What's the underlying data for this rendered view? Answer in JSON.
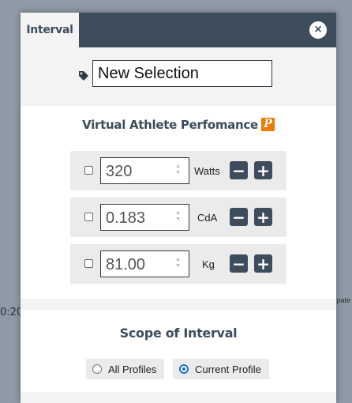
{
  "background": {
    "left_axis_label": "0:20",
    "right_axis_label": "pate"
  },
  "dialog": {
    "tab_label": "Interval",
    "close_icon": "close-icon",
    "name_field": {
      "value": "New Selection",
      "icon": "tag-icon"
    }
  },
  "performance": {
    "title": "Virtual Athlete Perfomance",
    "badge": "P",
    "rows": [
      {
        "value": "320",
        "unit": "Watts"
      },
      {
        "value": "0.183",
        "unit": "CdA"
      },
      {
        "value": "81.00",
        "unit": "Kg"
      }
    ],
    "minus_label": "−",
    "plus_label": "+"
  },
  "scope": {
    "title": "Scope of Interval",
    "options": [
      {
        "label": "All Profiles",
        "selected": false
      },
      {
        "label": "Current Profile",
        "selected": true
      }
    ]
  },
  "colors": {
    "header": "#3e4d5c",
    "accent": "#1a73c9",
    "badge": "#f07a00"
  }
}
